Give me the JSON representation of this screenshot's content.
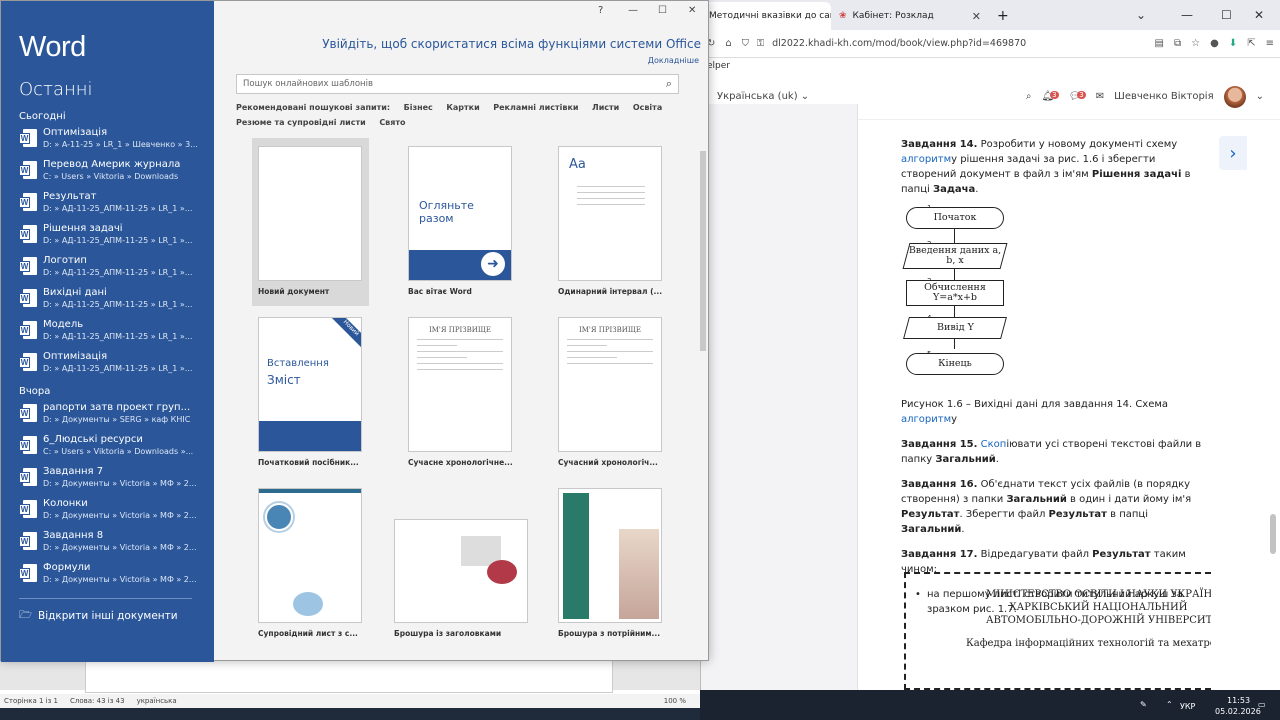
{
  "word": {
    "logo": "Word",
    "recent_title": "Останні",
    "section_today": "Сьогодні",
    "section_yesterday": "Вчора",
    "recent_today": [
      {
        "name": "Оптимізація",
        "path": "D: » A-11-25 » LR_1 » Шевченко » 3..."
      },
      {
        "name": "Перевод Америк журнала",
        "path": "C: » Users » Viktoria » Downloads"
      },
      {
        "name": "Результат",
        "path": "D: » АД-11-25_АПМ-11-25 » LR_1 »..."
      },
      {
        "name": "Рішення задачі",
        "path": "D: » АД-11-25_АПМ-11-25 » LR_1 »..."
      },
      {
        "name": "Логотип",
        "path": "D: » АД-11-25_АПМ-11-25 » LR_1 »..."
      },
      {
        "name": "Вихідні дані",
        "path": "D: » АД-11-25_АПМ-11-25 » LR_1 »..."
      },
      {
        "name": "Модель",
        "path": "D: » АД-11-25_АПМ-11-25 » LR_1 »..."
      },
      {
        "name": "Оптимізація",
        "path": "D: » АД-11-25_АПМ-11-25 » LR_1 »..."
      }
    ],
    "recent_yesterday": [
      {
        "name": "рапорти затв проект груп...",
        "path": "D: » Документы » SERG » каф КНІС"
      },
      {
        "name": "6_Людські ресурси",
        "path": "C: » Users » Viktoria » Downloads »..."
      },
      {
        "name": "Завдання 7",
        "path": "D: » Документы » Victoria » МФ » 2..."
      },
      {
        "name": "Колонки",
        "path": "D: » Документы » Victoria » МФ » 2..."
      },
      {
        "name": "Завдання 8",
        "path": "D: » Документы » Victoria » МФ » 2..."
      },
      {
        "name": "Формули",
        "path": "D: » Документы » Victoria » МФ » 2..."
      }
    ],
    "open_other": "Відкрити інші документи",
    "signin_text": "Увійдіть, щоб скористатися всіма функціями системи Office",
    "learn_more": "Докладніше",
    "search_placeholder": "Пошук онлайнових шаблонів",
    "suggested_label": "Рекомендовані пошукові запити:",
    "suggested": [
      "Бізнес",
      "Картки",
      "Рекламні листівки",
      "Листи",
      "Освіта"
    ],
    "suggested_row2": [
      "Резюме та супровідні листи",
      "Свято"
    ],
    "templates": [
      "Новий документ",
      "Вас вітає Word",
      "Одинарний інтервал (...",
      "Початковий посібник...",
      "Сучасне хронологічне...",
      "Сучасний хронологіч...",
      "Супровідний лист з с...",
      "Брошура із заголовками",
      "Брошура з потрійним..."
    ],
    "tpl_welcome_text": "Огляньте разом",
    "tpl_single_aa": "Аа",
    "tpl_insert_1": "Вставлення",
    "tpl_insert_2": "Зміст",
    "tpl_new_ribbon": "Новий",
    "tpl_resume_name": "ІМ'Я ПРІЗВИЩЕ",
    "window_controls": [
      "?",
      "—",
      "☐",
      "✕"
    ],
    "status_page": "Сторінка 1 із 1",
    "status_words": "Слова: 43 із 43",
    "status_lang": "українська",
    "status_zoom": "100 %"
  },
  "browser": {
    "tab1": "Методичні вказівки до самост",
    "tab2": "Кабінет: Розклад",
    "url": "dl2022.khadi-kh.com/mod/book/view.php?id=469870",
    "url_host": "khadi-kh.com",
    "bookmark": "elper",
    "lang": "Українська (uk)",
    "user": "Шевченко Вікторія",
    "badge1": "3",
    "badge2": "3"
  },
  "page": {
    "task14_label": "Завдання 14.",
    "task14_text1": " Розробити у новому документі схему ",
    "task14_link": "алгоритм",
    "task14_text2": "у рішення задачі за рис. 1.6 і зберегти створений документ в файл з ім'ям ",
    "task14_file": "Рішення задачі",
    "task14_text3": " в папці ",
    "task14_folder": "Задача",
    "flow": [
      {
        "num": "1",
        "text": "Початок"
      },
      {
        "num": "2",
        "text": "Введення даних a, b, x"
      },
      {
        "num": "3",
        "text": "Обчислення Y=a*x+b"
      },
      {
        "num": "4",
        "text": "Вивід Y"
      },
      {
        "num": "5",
        "text": "Кінець"
      }
    ],
    "fig_caption": "Рисунок 1.6 – Вихідні дані для завдання 14. Схема ",
    "fig_link": "алгоритм",
    "fig_tail": "у",
    "task15_label": "Завдання 15.",
    "task15_link": "Скоп",
    "task15_text": "іювати усі створені текстові файли в папку ",
    "task15_bold": "Загальний",
    "task16_label": "Завдання 16.",
    "task16_text1": " Об'єднати текст усіх файлів (в порядку створення) з папки ",
    "task16_b1": "Загальний",
    "task16_text2": " в один і дати йому ім'я ",
    "task16_b2": "Результат",
    "task16_text3": ". Зберегти файл ",
    "task16_b3": "Результат",
    "task16_text4": " в папці ",
    "task16_b4": "Загальний",
    "task17_label": "Завдання 17.",
    "task17_text1": " Відредагувати файл ",
    "task17_b1": "Результат",
    "task17_text2": " таким чином:",
    "bullet1": "на першому листі створити титульний аркуш за зразком рис. 1.7.",
    "ministry_1": "МІНІСТЕРСТВО  ОСВІТИ І НАУКИ УКРАЇН",
    "ministry_2": "ХАРКІВСЬКИЙ НАЦІОНАЛЬНИЙ",
    "ministry_3": "АВТОМОБІЛЬНО-ДОРОЖНІЙ УНІВЕРСИТ",
    "ministry_4": "Кафедра інформаційних технологій та мехатро"
  },
  "taskbar": {
    "lang": "УКР",
    "time": "11:53",
    "date": "05.02.2026"
  },
  "colors": {
    "word_blue": "#2b579a",
    "link_blue": "#1565c0"
  }
}
